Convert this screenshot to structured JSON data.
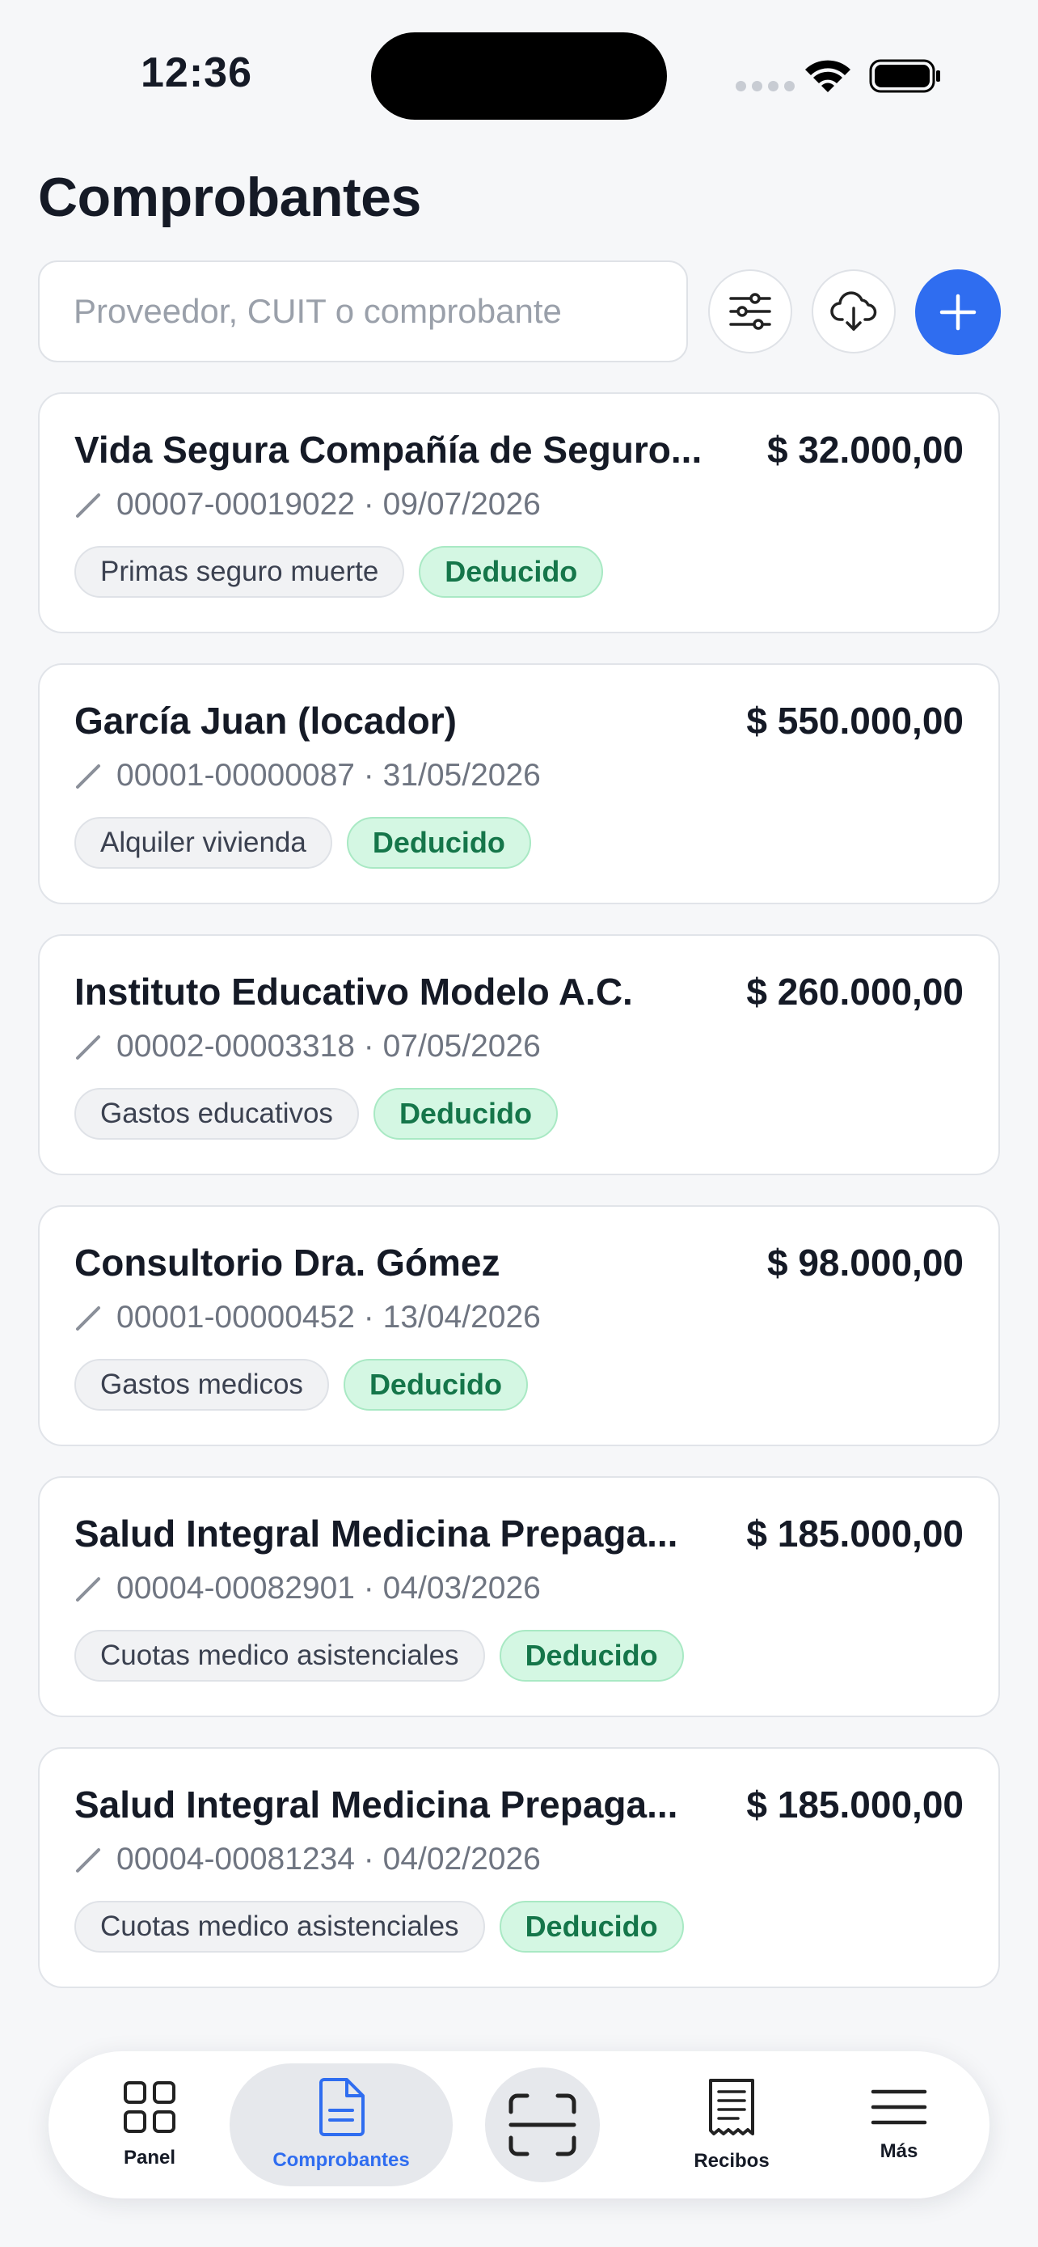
{
  "status_bar": {
    "time": "12:36"
  },
  "header": {
    "title": "Comprobantes"
  },
  "toolbar": {
    "search_placeholder": "Proveedor, CUIT o comprobante",
    "filter_icon": "sliders-icon",
    "download_icon": "cloud-download-icon",
    "add_icon": "plus-icon"
  },
  "colors": {
    "accent": "#2f6df0",
    "status_badge_bg": "#d4f7e3",
    "status_badge_text": "#15764a",
    "background": "#f6f7f9"
  },
  "receipts": [
    {
      "provider": "Vida Segura Compañía de Seguro...",
      "amount": "$ 32.000,00",
      "number": "00007-00019022",
      "date": "09/07/2026",
      "category": "Primas seguro muerte",
      "status": "Deducido"
    },
    {
      "provider": "García Juan (locador)",
      "amount": "$ 550.000,00",
      "number": "00001-00000087",
      "date": "31/05/2026",
      "category": "Alquiler vivienda",
      "status": "Deducido"
    },
    {
      "provider": "Instituto Educativo Modelo A.C.",
      "amount": "$ 260.000,00",
      "number": "00002-00003318",
      "date": "07/05/2026",
      "category": "Gastos educativos",
      "status": "Deducido"
    },
    {
      "provider": "Consultorio Dra. Gómez",
      "amount": "$ 98.000,00",
      "number": "00001-00000452",
      "date": "13/04/2026",
      "category": "Gastos medicos",
      "status": "Deducido"
    },
    {
      "provider": "Salud Integral Medicina Prepaga...",
      "amount": "$ 185.000,00",
      "number": "00004-00082901",
      "date": "04/03/2026",
      "category": "Cuotas medico asistenciales",
      "status": "Deducido"
    },
    {
      "provider": "Salud Integral Medicina Prepaga...",
      "amount": "$ 185.000,00",
      "number": "00004-00081234",
      "date": "04/02/2026",
      "category": "Cuotas medico asistenciales",
      "status": "Deducido"
    }
  ],
  "nav": {
    "panel": "Panel",
    "comprobantes": "Comprobantes",
    "scan_icon": "scan-icon",
    "recibos": "Recibos",
    "mas": "Más",
    "active": "Comprobantes"
  }
}
